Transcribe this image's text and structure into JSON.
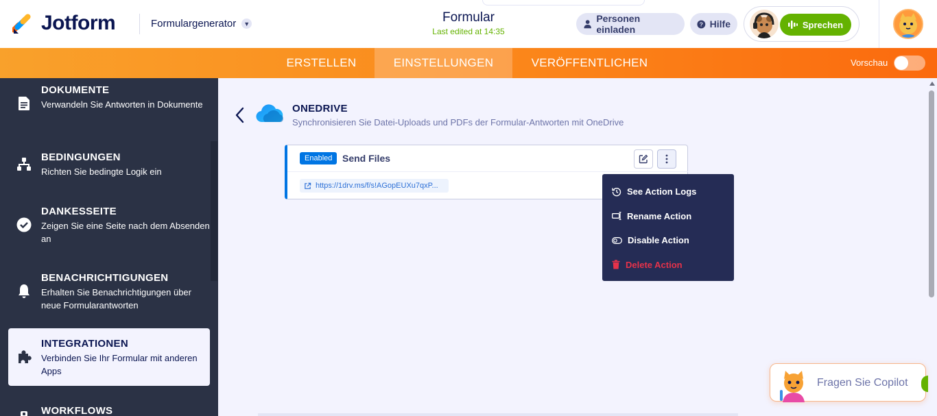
{
  "header": {
    "brand": "Jotform",
    "builder_label": "Formulargenerator",
    "form_title": "Formular",
    "last_edited": "Last edited at 14:35",
    "invite_label": "Personen einladen",
    "help_label": "Hilfe",
    "speak_label": "Sprechen"
  },
  "nav": {
    "tabs": [
      {
        "label": "ERSTELLEN"
      },
      {
        "label": "EINSTELLUNGEN",
        "active": true
      },
      {
        "label": "VERÖFFENTLICHEN"
      }
    ],
    "preview_label": "Vorschau",
    "preview_on": false
  },
  "sidebar": {
    "items": [
      {
        "title": "DOKUMENTE",
        "subtitle": "Verwandeln Sie Antworten in Dokumente",
        "icon": "document-icon"
      },
      {
        "title": "BEDINGUNGEN",
        "subtitle": "Richten Sie bedingte Logik ein",
        "icon": "conditions-icon"
      },
      {
        "title": "DANKESSEITE",
        "subtitle": "Zeigen Sie eine Seite nach dem Absenden an",
        "icon": "check-circle-icon"
      },
      {
        "title": "BENACHRICHTIGUNGEN",
        "subtitle": "Erhalten Sie Benachrichtigungen über neue Formularantworten",
        "icon": "bell-icon"
      },
      {
        "title": "INTEGRATIONEN",
        "subtitle": "Verbinden Sie Ihr Formular mit anderen Apps",
        "icon": "puzzle-icon",
        "active": true
      },
      {
        "title": "WORKFLOWS",
        "subtitle": "",
        "icon": "workflow-icon"
      }
    ]
  },
  "integration": {
    "name": "ONEDRIVE",
    "description": "Synchronisieren Sie Datei-Uploads und PDFs der Formular-Antworten mit OneDrive"
  },
  "action_card": {
    "status": "Enabled",
    "name": "Send Files",
    "link": "https://1drv.ms/f/s!AGopEUXu7qxP..."
  },
  "context_menu": {
    "items": [
      {
        "label": "See Action Logs",
        "icon": "history-icon"
      },
      {
        "label": "Rename Action",
        "icon": "rename-icon"
      },
      {
        "label": "Disable Action",
        "icon": "toggle-off-icon"
      },
      {
        "label": "Delete Action",
        "icon": "trash-icon",
        "danger": true
      }
    ]
  },
  "copilot": {
    "ask_label": "Fragen Sie Copilot"
  },
  "colors": {
    "brand_orange": "#fb8a1c",
    "sidebar_bg": "#2b3245",
    "accent_blue": "#0075e3",
    "menu_bg": "#252c55",
    "danger": "#e6324a",
    "speak_green": "#64b200"
  }
}
